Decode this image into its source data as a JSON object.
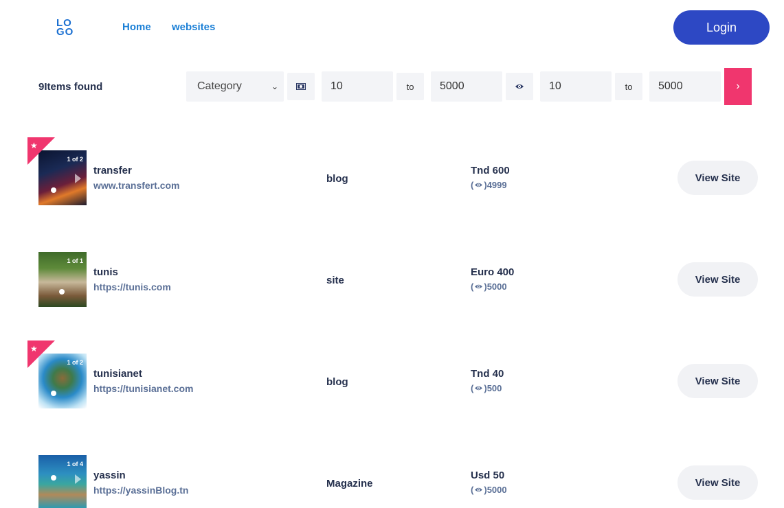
{
  "header": {
    "logo_line1": "LO",
    "logo_line2": "GO",
    "nav_home": "Home",
    "nav_websites": "websites",
    "login": "Login"
  },
  "filters": {
    "items_found": "9Items found",
    "category": "Category",
    "price_min": "10",
    "to_label": "to",
    "price_max": "5000",
    "views_min": "10",
    "views_max": "5000",
    "go_symbol": "›"
  },
  "rows": [
    {
      "name": "transfer",
      "url": "www.transfert.com",
      "category": "blog",
      "price": "Tnd 600",
      "views": "4999",
      "counter": "1 of 2",
      "featured": true
    },
    {
      "name": "tunis",
      "url": "https://tunis.com",
      "category": "site",
      "price": "Euro 400",
      "views": "5000",
      "counter": "1 of 1",
      "featured": false
    },
    {
      "name": "tunisianet",
      "url": "https://tunisianet.com",
      "category": "blog",
      "price": "Tnd 40",
      "views": "500",
      "counter": "1 of 2",
      "featured": true
    },
    {
      "name": "yassin",
      "url": "https://yassinBlog.tn",
      "category": "Magazine",
      "price": "Usd 50",
      "views": "5000",
      "counter": "1 of 4",
      "featured": false
    }
  ],
  "view_site_label": "View Site",
  "colors": {
    "accent": "#2d48c4",
    "pink": "#f0366e",
    "nav": "#1a7fd6"
  }
}
